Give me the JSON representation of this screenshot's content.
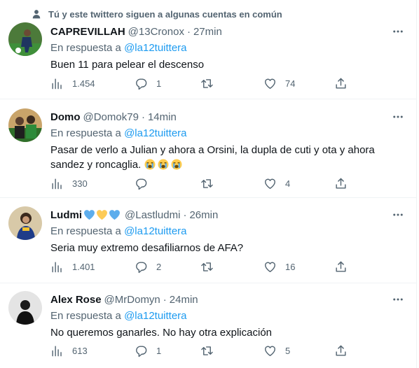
{
  "social_context": {
    "text": "Tú y este twittero siguen a algunas cuentas en común",
    "icon": "person-icon"
  },
  "reply_prefix": "En respuesta a",
  "tweets": [
    {
      "name": "CAPREVILLAH",
      "handle": "@13Cronox",
      "time": "27min",
      "reply_to": "@la12tuittera",
      "text": "Buen 11 para pelear el descenso",
      "views": "1.454",
      "replies": "1",
      "retweets": "",
      "likes": "74"
    },
    {
      "name": "Domo",
      "handle": "@Domok79",
      "time": "14min",
      "reply_to": "@la12tuittera",
      "text": "Pasar de verlo a Julian y ahora a Orsini, la dupla de cuti y ota y ahora sandez y roncaglia.",
      "text_emojis": [
        "loudly-crying-face",
        "loudly-crying-face",
        "loudly-crying-face"
      ],
      "views": "330",
      "replies": "",
      "retweets": "",
      "likes": "4"
    },
    {
      "name": "Ludmi",
      "name_emojis": [
        "blue-heart",
        "yellow-heart",
        "blue-heart"
      ],
      "handle": "@Lastludmi",
      "time": "26min",
      "reply_to": "@la12tuittera",
      "text": "Seria muy extremo desafiliarnos de AFA?",
      "views": "1.401",
      "replies": "2",
      "retweets": "",
      "likes": "16"
    },
    {
      "name": "Alex Rose",
      "handle": "@MrDomyn",
      "time": "24min",
      "reply_to": "@la12tuittera",
      "text": "No queremos ganarles. No hay otra explicación",
      "views": "613",
      "replies": "1",
      "retweets": "",
      "likes": "5"
    }
  ],
  "colors": {
    "text": "#0f1419",
    "secondary": "#536471",
    "link": "#1d9bf0",
    "divider": "#eff3f4"
  }
}
